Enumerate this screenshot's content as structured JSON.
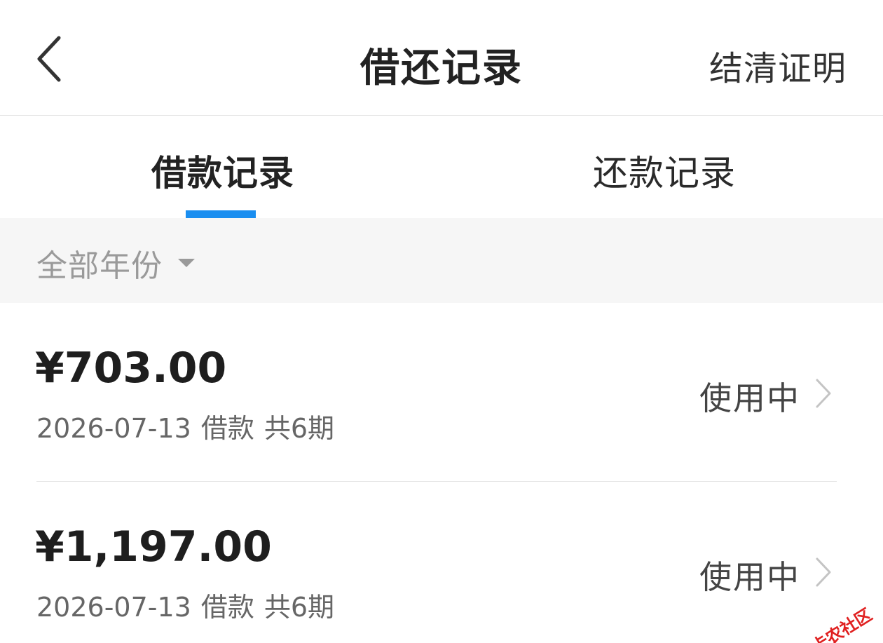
{
  "header": {
    "back_icon": "chevron-left-icon",
    "title": "借还记录",
    "action_label": "结清证明"
  },
  "tabs": [
    {
      "label": "借款记录",
      "active": true
    },
    {
      "label": "还款记录",
      "active": false
    }
  ],
  "accent_color": "#1a8ef0",
  "filter": {
    "label": "全部年份",
    "icon": "caret-down-icon"
  },
  "records": [
    {
      "amount": "¥703.00",
      "date": "2026-07-13",
      "type": "借款",
      "installments": "共6期",
      "status": "使用中",
      "icon": "chevron-right-icon"
    },
    {
      "amount": "¥1,197.00",
      "date": "2026-07-13",
      "type": "借款",
      "installments": "共6期",
      "status": "使用中",
      "icon": "chevron-right-icon"
    }
  ],
  "watermark": {
    "text": "卡农社区",
    "color": "#e02020"
  }
}
